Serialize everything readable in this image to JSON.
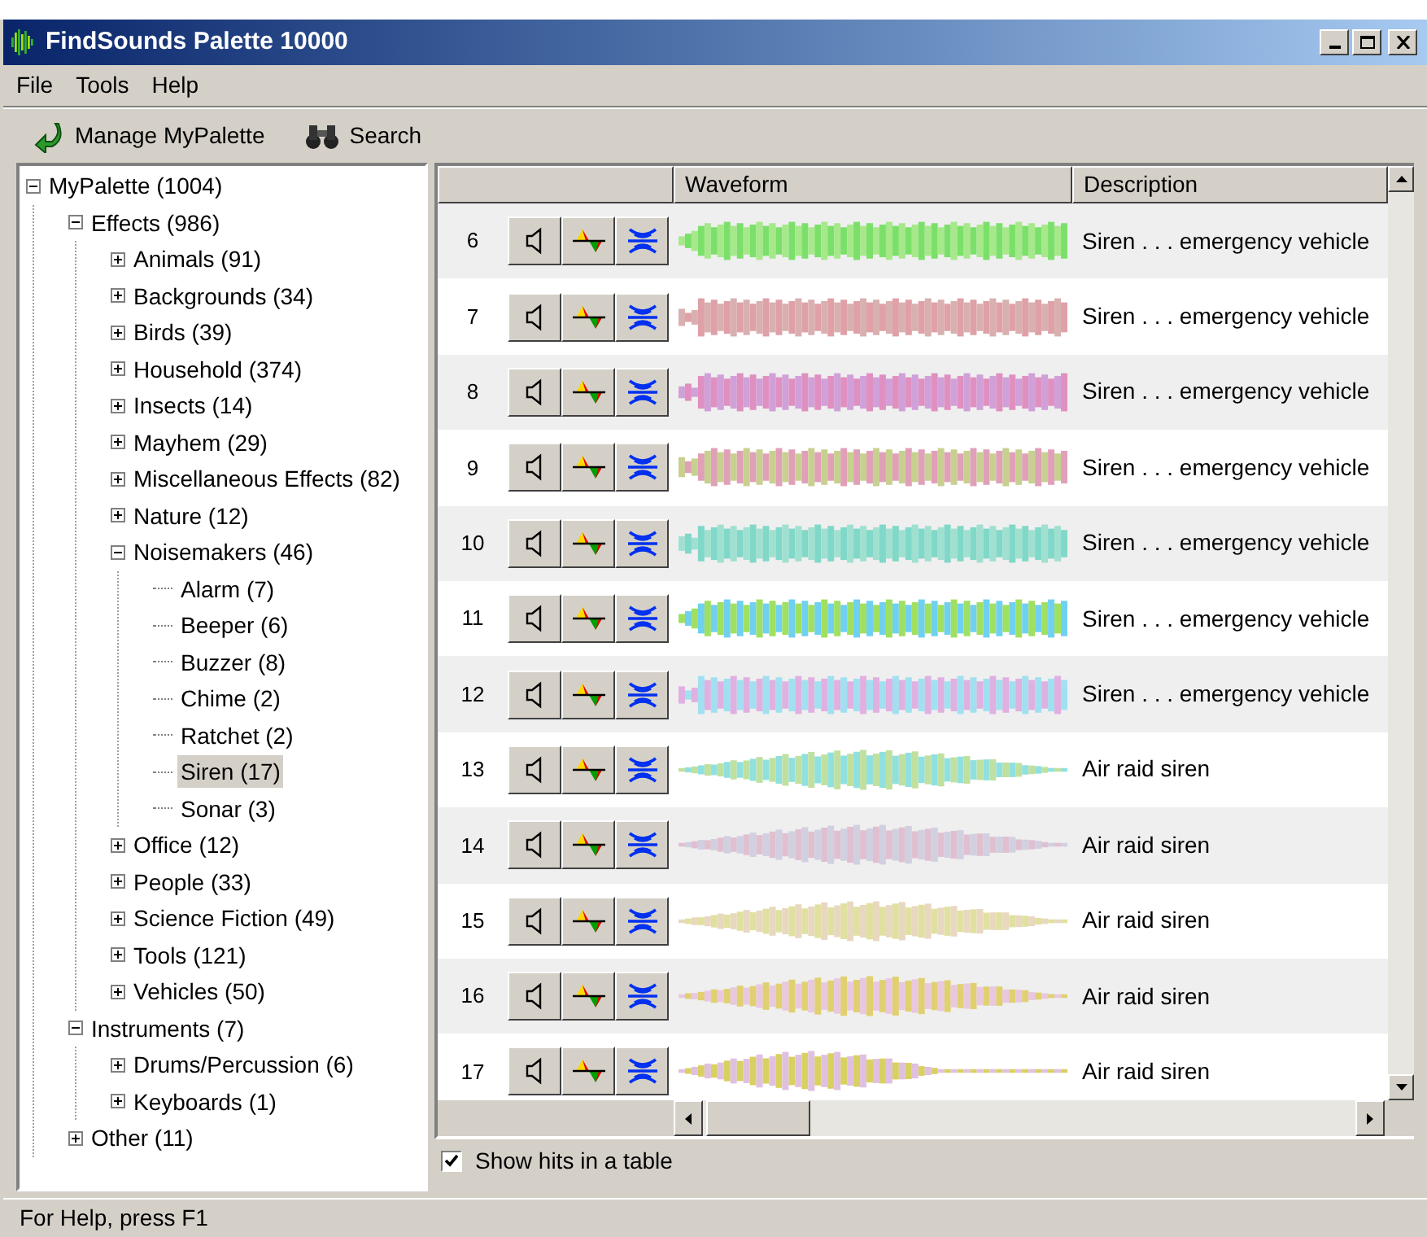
{
  "window": {
    "title": "FindSounds Palette 10000"
  },
  "menu": [
    "File",
    "Tools",
    "Help"
  ],
  "toolbar": [
    {
      "label": "Manage MyPalette",
      "kind": "manage"
    },
    {
      "label": "Search",
      "kind": "search"
    }
  ],
  "tree": [
    {
      "label": "MyPalette (1004)",
      "expanded": true,
      "selected": false,
      "children": [
        {
          "label": "Effects (986)",
          "expanded": true,
          "selected": false,
          "children": [
            {
              "label": "Animals (91)",
              "expanded": false,
              "selected": false
            },
            {
              "label": "Backgrounds (34)",
              "expanded": false,
              "selected": false
            },
            {
              "label": "Birds (39)",
              "expanded": false,
              "selected": false
            },
            {
              "label": "Household (374)",
              "expanded": false,
              "selected": false
            },
            {
              "label": "Insects (14)",
              "expanded": false,
              "selected": false
            },
            {
              "label": "Mayhem (29)",
              "expanded": false,
              "selected": false
            },
            {
              "label": "Miscellaneous Effects (82)",
              "expanded": false,
              "selected": false
            },
            {
              "label": "Nature (12)",
              "expanded": false,
              "selected": false
            },
            {
              "label": "Noisemakers (46)",
              "expanded": true,
              "selected": false,
              "children": [
                {
                  "label": "Alarm (7)",
                  "selected": false
                },
                {
                  "label": "Beeper (6)",
                  "selected": false
                },
                {
                  "label": "Buzzer (8)",
                  "selected": false
                },
                {
                  "label": "Chime (2)",
                  "selected": false
                },
                {
                  "label": "Ratchet (2)",
                  "selected": false
                },
                {
                  "label": "Siren (17)",
                  "selected": true
                },
                {
                  "label": "Sonar (3)",
                  "selected": false
                }
              ]
            },
            {
              "label": "Office (12)",
              "expanded": false,
              "selected": false
            },
            {
              "label": "People (33)",
              "expanded": false,
              "selected": false
            },
            {
              "label": "Science Fiction (49)",
              "expanded": false,
              "selected": false
            },
            {
              "label": "Tools (121)",
              "expanded": false,
              "selected": false
            },
            {
              "label": "Vehicles (50)",
              "expanded": false,
              "selected": false
            }
          ]
        },
        {
          "label": "Instruments (7)",
          "expanded": true,
          "selected": false,
          "children": [
            {
              "label": "Drums/Percussion (6)",
              "expanded": false,
              "selected": false
            },
            {
              "label": "Keyboards (1)",
              "expanded": false,
              "selected": false
            }
          ]
        },
        {
          "label": "Other (11)",
          "expanded": false,
          "selected": false
        }
      ]
    }
  ],
  "table": {
    "columns": [
      "Waveform",
      "Description"
    ],
    "rows": [
      {
        "number": "6",
        "description": "Siren . . . emergency vehicle"
      },
      {
        "number": "7",
        "description": "Siren . . . emergency vehicle"
      },
      {
        "number": "8",
        "description": "Siren . . . emergency vehicle"
      },
      {
        "number": "9",
        "description": "Siren . . . emergency vehicle"
      },
      {
        "number": "10",
        "description": "Siren . . . emergency vehicle"
      },
      {
        "number": "11",
        "description": "Siren . . . emergency vehicle"
      },
      {
        "number": "12",
        "description": "Siren . . . emergency vehicle"
      },
      {
        "number": "13",
        "description": "Air raid siren"
      },
      {
        "number": "14",
        "description": "Air raid siren"
      },
      {
        "number": "15",
        "description": "Air raid siren"
      },
      {
        "number": "16",
        "description": "Air raid siren"
      },
      {
        "number": "17",
        "description": "Air raid siren"
      }
    ]
  },
  "show_hits": {
    "label": "Show hits in a table",
    "checked": true
  },
  "status_bar": "For Help, press F1"
}
